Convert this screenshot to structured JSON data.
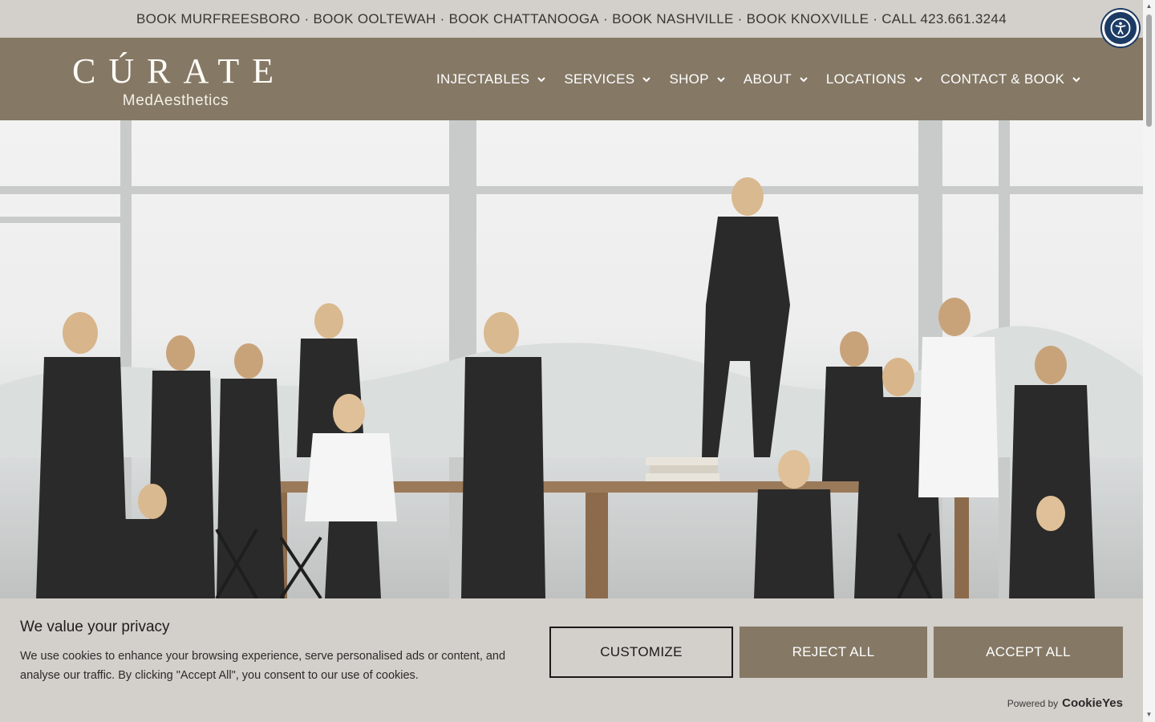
{
  "topbar": {
    "items": [
      "BOOK MURFREESBORO",
      "BOOK OOLTEWAH",
      "BOOK CHATTANOOGA",
      "BOOK NASHVILLE",
      "BOOK KNOXVILLE",
      "CALL 423.661.3244"
    ],
    "separator": " · "
  },
  "header": {
    "brand": "CÚRATE",
    "brand_sub": "MedAesthetics",
    "nav": [
      {
        "label": "INJECTABLES"
      },
      {
        "label": "SERVICES"
      },
      {
        "label": "SHOP"
      },
      {
        "label": "ABOUT"
      },
      {
        "label": "LOCATIONS"
      },
      {
        "label": "CONTACT & BOOK"
      }
    ]
  },
  "hero": {
    "image_alt_icon": "team-photo-image"
  },
  "cookie": {
    "title": "We value your privacy",
    "body": "We use cookies to enhance your browsing experience, serve personalised ads or content, and analyse our traffic. By clicking \"Accept All\", you consent to our use of cookies.",
    "customize": "CUSTOMIZE",
    "reject": "REJECT ALL",
    "accept": "ACCEPT ALL",
    "powered_by": "Powered by",
    "powered_brand": "CookieYes"
  },
  "colors": {
    "brand_brown": "#857966",
    "topbar_bg": "#d3cfca",
    "accessibility_blue": "#1c3b64"
  }
}
